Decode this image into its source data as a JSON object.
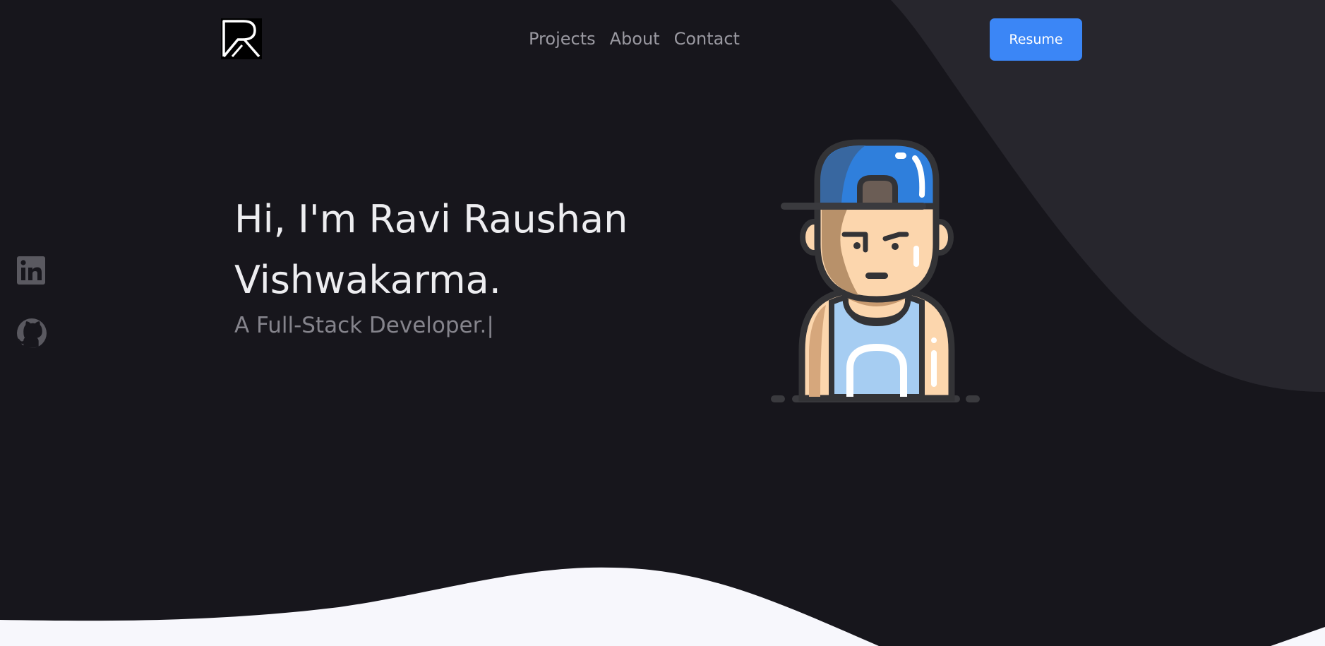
{
  "header": {
    "logo_alt": "R",
    "nav": {
      "projects_label": "Projects",
      "about_label": "About",
      "contact_label": "Contact"
    },
    "resume_label": "Resume"
  },
  "social": [
    {
      "icon": "linkedin-icon"
    },
    {
      "icon": "github-icon"
    }
  ],
  "hero": {
    "title": "Hi, I'm Ravi Raushan Vishwakarma.",
    "subtitle": "A Full-Stack Developer.|"
  },
  "colors": {
    "background": "#17161c",
    "accent_blob": "#27262d",
    "bottom_wave": "#f7f7fc",
    "primary": "#3b86f6",
    "heading": "#ededf0",
    "muted": "#85848c",
    "nav_text": "#9a99a1"
  }
}
